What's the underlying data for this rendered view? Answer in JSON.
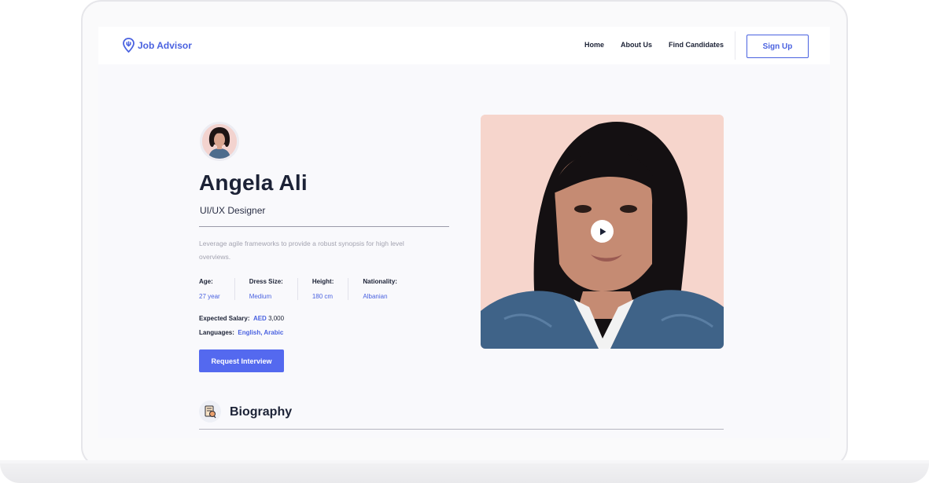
{
  "brand": {
    "name": "Job Advisor",
    "accent": "#4a62e0"
  },
  "nav": {
    "links": [
      "Home",
      "About Us",
      "Find Candidates"
    ],
    "signup_label": "Sign Up"
  },
  "profile": {
    "name": "Angela Ali",
    "role": "UI/UX Designer",
    "summary": "Leverage agile frameworks to provide a robust synopsis for high level overviews.",
    "facts": [
      {
        "label": "Age:",
        "value": "27 year"
      },
      {
        "label": "Dress Size:",
        "value": "Medium"
      },
      {
        "label": "Height:",
        "value": "180 cm"
      },
      {
        "label": "Nationality:",
        "value": "Albanian"
      }
    ],
    "salary": {
      "label": "Expected Salary:",
      "currency": "AED",
      "amount": "3,000"
    },
    "languages": {
      "label": "Languages:",
      "value": "English, Arabic"
    },
    "cta_label": "Request Interview"
  },
  "biography": {
    "title": "Biography"
  },
  "icons": [
    "logo-pin-icon",
    "play-icon",
    "biography-icon"
  ]
}
